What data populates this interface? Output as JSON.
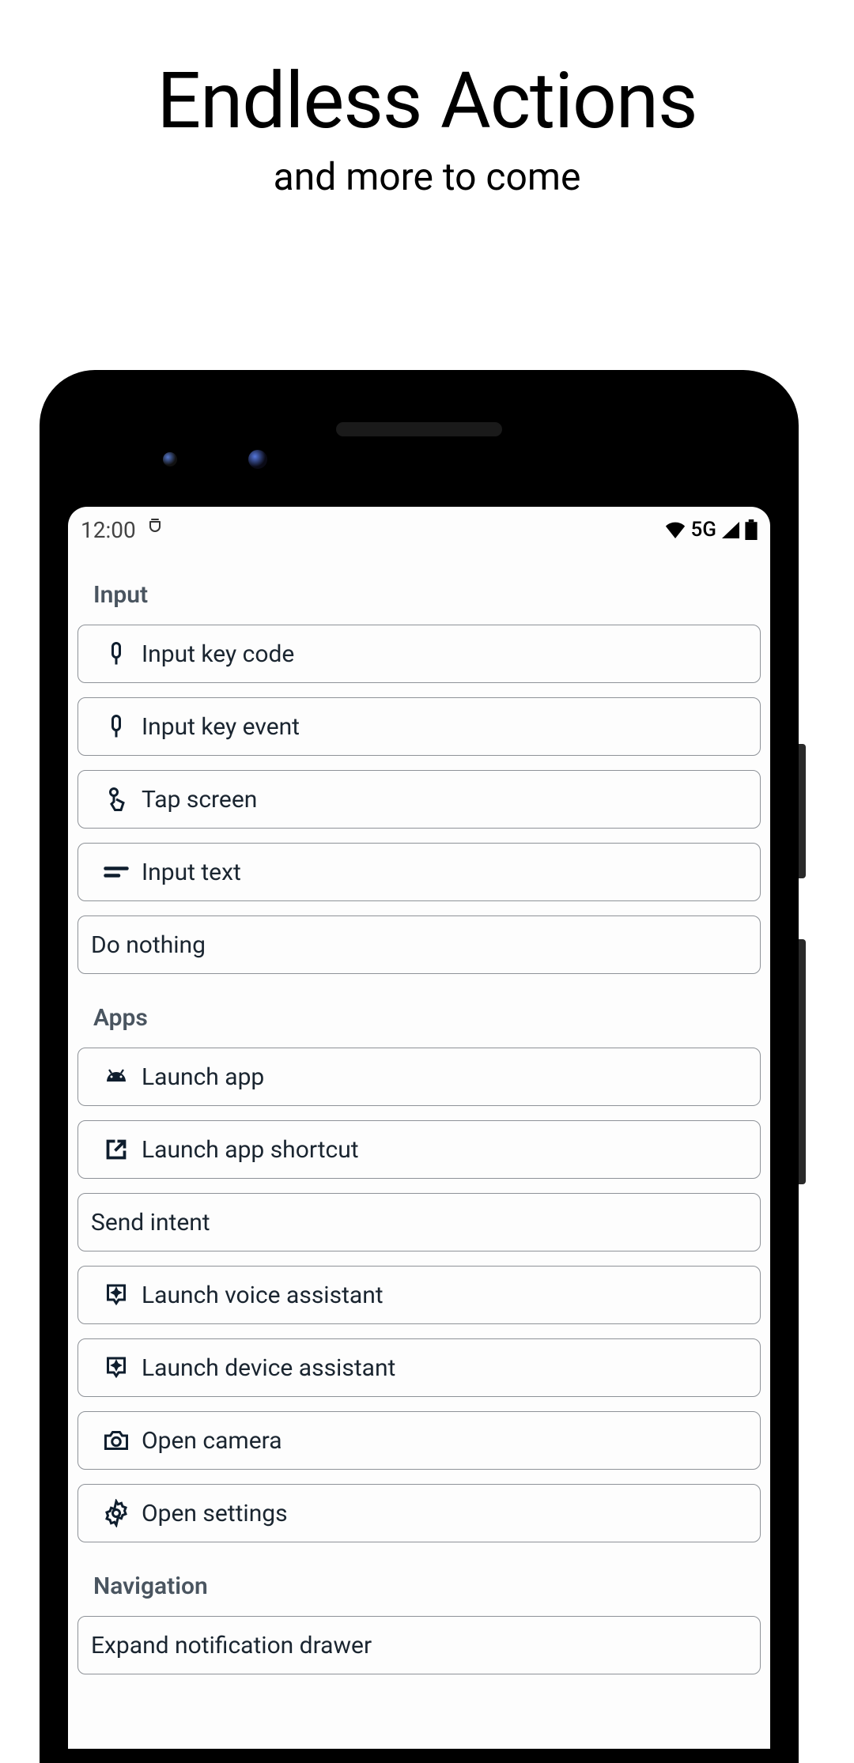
{
  "header": {
    "title": "Endless Actions",
    "subtitle": "and more to come"
  },
  "statusbar": {
    "time": "12:00",
    "network": "5G"
  },
  "sections": [
    {
      "title": "Input",
      "items": [
        {
          "icon": "key-icon",
          "label": "Input key code"
        },
        {
          "icon": "key-icon",
          "label": "Input key event"
        },
        {
          "icon": "touch-icon",
          "label": "Tap screen"
        },
        {
          "icon": "text-icon",
          "label": "Input text"
        },
        {
          "icon": null,
          "label": "Do nothing"
        }
      ]
    },
    {
      "title": "Apps",
      "items": [
        {
          "icon": "android-icon",
          "label": "Launch app"
        },
        {
          "icon": "open-in-new-icon",
          "label": "Launch app shortcut"
        },
        {
          "icon": null,
          "label": "Send intent"
        },
        {
          "icon": "assistant-icon",
          "label": "Launch voice assistant"
        },
        {
          "icon": "assistant-icon",
          "label": "Launch device assistant"
        },
        {
          "icon": "camera-icon",
          "label": "Open camera"
        },
        {
          "icon": "settings-icon",
          "label": "Open settings"
        }
      ]
    },
    {
      "title": "Navigation",
      "items": [
        {
          "icon": null,
          "label": "Expand notification drawer"
        }
      ]
    }
  ]
}
